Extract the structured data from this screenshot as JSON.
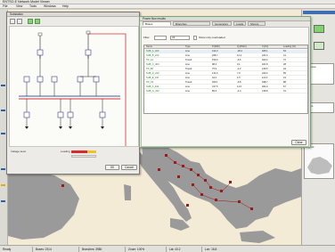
{
  "titlebar": {
    "title": "ENTSO-E  Network Model Viewer"
  },
  "menubar": {
    "items": [
      "File",
      "View",
      "Tools",
      "Windows",
      "Help"
    ]
  },
  "diagram_window": {
    "title": "Substation",
    "tools": [
      "pointer-icon",
      "zoom-icon",
      "hand-icon",
      "fit-icon"
    ],
    "legend": {
      "left_label": "Voltage level",
      "right_label": "Loading"
    },
    "loading_colors": [
      "#d92b2b",
      "#f2c12e"
    ],
    "buttons": {
      "ok": "OK",
      "cancel": "Cancel"
    }
  },
  "table_window": {
    "title": "Power flow results",
    "tabs": [
      "Buses",
      "Branches",
      "Generators",
      "Loads",
      "Shunts"
    ],
    "filter": {
      "label": "Filter",
      "value": "All",
      "option": "Show only overloaded"
    },
    "headers": [
      "Name",
      "Type",
      "P [MW]",
      "Q [MVAr]",
      "V [kV]",
      "Loading [%]"
    ],
    "rows": [
      [
        "SUB_A_400",
        "Line",
        "412.3",
        "-18.2",
        "405.1",
        "63"
      ],
      [
        "SUB_B_220",
        "Line",
        "208.7",
        "12.4",
        "221.6",
        "41"
      ],
      [
        "TR_A1",
        "Transf.",
        "150.0",
        "-5.6",
        "400.2",
        "72"
      ],
      [
        "SUB_C_400",
        "Line",
        "98.4",
        "3.1",
        "401.8",
        "28"
      ],
      [
        "TR_B2",
        "Transf.",
        "75.9",
        "-2.2",
        "219.5",
        "34"
      ],
      [
        "SUB_D_220",
        "Line",
        "131.6",
        "7.9",
        "220.4",
        "55"
      ],
      [
        "SUB_E_110",
        "Line",
        "44.2",
        "1.5",
        "112.3",
        "19"
      ],
      [
        "TR_C3",
        "Transf.",
        "260.1",
        "-9.8",
        "398.7",
        "88"
      ],
      [
        "SUB_F_400",
        "Line",
        "317.5",
        "14.6",
        "404.9",
        "67"
      ],
      [
        "SUB_G_220",
        "Line",
        "89.3",
        "-4.0",
        "218.8",
        "31"
      ]
    ],
    "ok_button": "Close"
  },
  "right_panel": {
    "title": "Overview",
    "items": [
      "Layers",
      "Legend"
    ]
  },
  "statusbar": {
    "items": [
      "Ready",
      "Buses: 2314",
      "Branches: 3980",
      "Zoom: 100%",
      "Lat: 43.2",
      "Lon: 16.8"
    ]
  },
  "colors": {
    "selection": "#3f6fb0",
    "map_land": "#9a9a9a",
    "map_sea": "#f4ebd7",
    "red_markers": "#9b1b1b"
  }
}
